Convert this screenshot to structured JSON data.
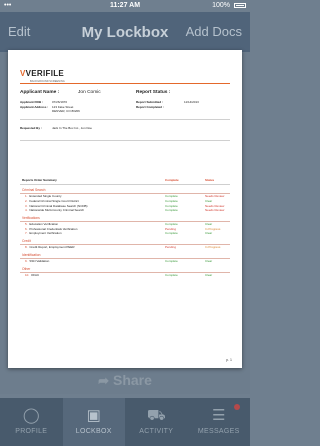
{
  "status_bar": {
    "carrier": "•••",
    "time": "11:27 AM",
    "battery": "100%"
  },
  "nav": {
    "left": "Edit",
    "title": "My Lockbox",
    "right": "Add Docs"
  },
  "share": {
    "label": "Share"
  },
  "tabs": [
    {
      "label": "PROFILE",
      "icon": "person-icon",
      "active": false
    },
    {
      "label": "LOCKBOX",
      "icon": "lockbox-icon",
      "active": true
    },
    {
      "label": "ACTIVITY",
      "icon": "truck-icon",
      "active": false
    },
    {
      "label": "MESSAGES",
      "icon": "messages-icon",
      "active": false
    }
  ],
  "report": {
    "logo_text": "VERIFILE",
    "logo_mark": "V",
    "logo_tag": "BACKGROUND SCREENING",
    "applicant_name_label": "Applicant Name :",
    "applicant_name": "Jon Comic",
    "report_status_label": "Report Status :",
    "left_fields": [
      {
        "label": "Applicant DOB :",
        "value": "07/26/1970"
      },
      {
        "label": "Applicant Address :",
        "value": "123 Fake Street"
      },
      {
        "label": "",
        "value": "DENVER, CO 80206"
      }
    ],
    "right_fields": [
      {
        "label": "Report Submitted :",
        "value": "11/14/2013"
      },
      {
        "label": "Report Completed :",
        "value": ""
      }
    ],
    "requested_by_label": "Requested By :",
    "requested_by": "Jack In The Box Inc., Jon Doe",
    "summary_label": "Reports Order Summary",
    "summary_col1": "Complete",
    "summary_col2": "Status",
    "sections": [
      {
        "title": "Criminal Search",
        "items": [
          {
            "num": "1.",
            "name": "Extended Single County",
            "status": "Complete",
            "status2": "Needs Review"
          },
          {
            "num": "2.",
            "name": "Federal Criminal Single Court District",
            "status": "Complete",
            "status2": "Clear"
          },
          {
            "num": "3.",
            "name": "National Criminal Database Search (NCDB)",
            "status": "Complete",
            "status2": "Needs Review"
          },
          {
            "num": "4.",
            "name": "Nationwide Multi-County Criminal Search",
            "status": "Complete",
            "status2": "Needs Review"
          }
        ]
      },
      {
        "title": "Verifications",
        "items": [
          {
            "num": "5.",
            "name": "Education Verification",
            "status": "Complete",
            "status2": "Clear"
          },
          {
            "num": "6.",
            "name": "Professional Credentials Verification",
            "status": "Pending",
            "status2": "In Progress"
          },
          {
            "num": "7.",
            "name": "Employment Verification",
            "status": "Complete",
            "status2": "Clear"
          }
        ]
      },
      {
        "title": "Credit",
        "items": [
          {
            "num": "8.",
            "name": "Credit Report, Employment PEER",
            "status": "Pending",
            "status2": "In Progress"
          }
        ]
      },
      {
        "title": "Identification",
        "items": [
          {
            "num": "9.",
            "name": "SSN Validation",
            "status": "Complete",
            "status2": "Clear"
          }
        ]
      },
      {
        "title": "Other",
        "items": [
          {
            "num": "10.",
            "name": "OFAC",
            "status": "Complete",
            "status2": "Clear"
          }
        ]
      }
    ],
    "page_number": "p. 1"
  },
  "colors": {
    "accent": "#e4682b",
    "status_red": "#d13b2f",
    "status_green": "#3c9a3c",
    "nav_bg": "#50647a"
  }
}
